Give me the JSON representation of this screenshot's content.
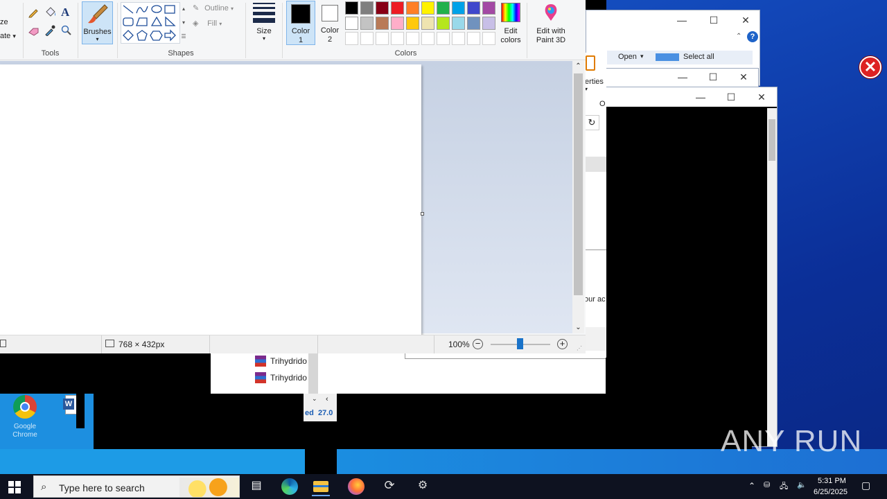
{
  "paint": {
    "ribbon": {
      "clipboard_partial": [
        "ze",
        "ate"
      ],
      "tools_label": "Tools",
      "brushes_label": "Brushes",
      "shapes_label": "Shapes",
      "outline_label": "Outline",
      "fill_label": "Fill",
      "size_label": "Size",
      "color1_label": "Color",
      "color1_num": "1",
      "color2_label": "Color",
      "color2_num": "2",
      "colors_label": "Colors",
      "edit_colors_label": "Edit colors",
      "edit_paint3d_label": "Edit with Paint 3D",
      "text_tool_glyph": "A",
      "palette_row1": [
        "#000000",
        "#7f7f7f",
        "#880015",
        "#ed1c24",
        "#ff7f27",
        "#fff200",
        "#22b14c",
        "#00a2e8",
        "#3f48cc",
        "#a349a4"
      ],
      "palette_row2": [
        "#ffffff",
        "#c3c3c3",
        "#b97a57",
        "#ffaec9",
        "#ffc90e",
        "#efe4b0",
        "#b5e61d",
        "#99d9ea",
        "#7092be",
        "#c8bfe7"
      ]
    },
    "status": {
      "dimensions": "768 × 432px",
      "zoom": "100%"
    }
  },
  "background": {
    "explorer": {
      "open_label": "Open",
      "select_all_label": "Select all",
      "properties_partial": "erties",
      "text_partial_1": "our ac",
      "section_partial": "O"
    },
    "file_list": [
      "Trihydrido",
      "Trihydrido"
    ],
    "status_partial": "ed  27.0"
  },
  "desktop": {
    "icons": [
      {
        "label": "Google Chrome"
      },
      {
        "label": ""
      }
    ]
  },
  "taskbar": {
    "search_placeholder": "Type here to search",
    "time": "5:31 PM",
    "date": "6/25/2025"
  },
  "watermark": "ANY RUN"
}
